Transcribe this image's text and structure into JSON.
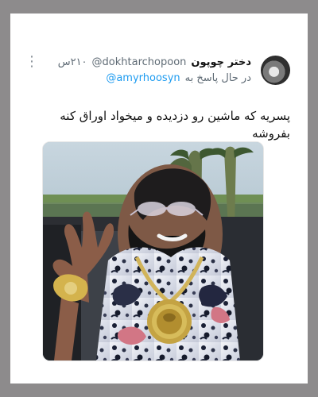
{
  "tweet": {
    "display_name": "دختر چوپون",
    "username": "@dokhtarchopoon",
    "timestamp": "۲۱۰س",
    "reply_prefix": "در حال پاسخ به",
    "reply_handle": "@amyrhoosyn",
    "body": "پسریه که ماشین رو دزدیده و میخواد اوراق کنه بفروشه",
    "more_icon": "⋮"
  },
  "colors": {
    "background": "#8d8b8c",
    "card": "#ffffff",
    "text": "#111111",
    "secondary": "#5f6b75",
    "link": "#1d9bf0"
  },
  "icons": {
    "more": "vertical-ellipsis-icon",
    "avatar": "profile-avatar-icon"
  }
}
